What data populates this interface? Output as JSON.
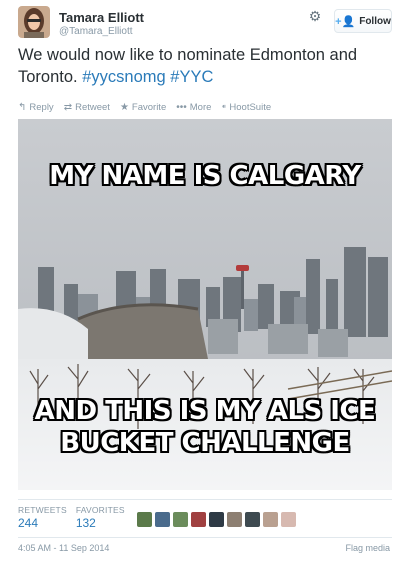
{
  "tweet": {
    "author_name": "Tamara Elliott",
    "author_handle": "@Tamara_Elliott",
    "text_plain": "We would now like to nominate Edmonton and Toronto.",
    "hashtags": [
      "#yycsnomg",
      "#YYC"
    ],
    "follow_label": "Follow",
    "timestamp": "4:05 AM - 11 Sep 2014",
    "flag_label": "Flag media"
  },
  "actions": [
    {
      "label": "Reply",
      "icon": "reply-icon"
    },
    {
      "label": "Retweet",
      "icon": "retweet-icon"
    },
    {
      "label": "Favorite",
      "icon": "star-icon"
    },
    {
      "label": "More",
      "icon": "more-icon"
    },
    {
      "label": "HootSuite",
      "icon": "hootsuite-icon"
    }
  ],
  "media": {
    "top_text": "MY NAME IS CALGARY",
    "bottom_line1": "AND THIS IS MY ALS ICE",
    "bottom_line2": "BUCKET CHALLENGE"
  },
  "stats": {
    "retweets_label": "RETWEETS",
    "retweets_value": "244",
    "favorites_label": "FAVORITES",
    "favorites_value": "132"
  },
  "colors": {
    "link": "#2b7bb9",
    "muted": "#8899a6",
    "text": "#292f33",
    "accent": "#55acee"
  }
}
